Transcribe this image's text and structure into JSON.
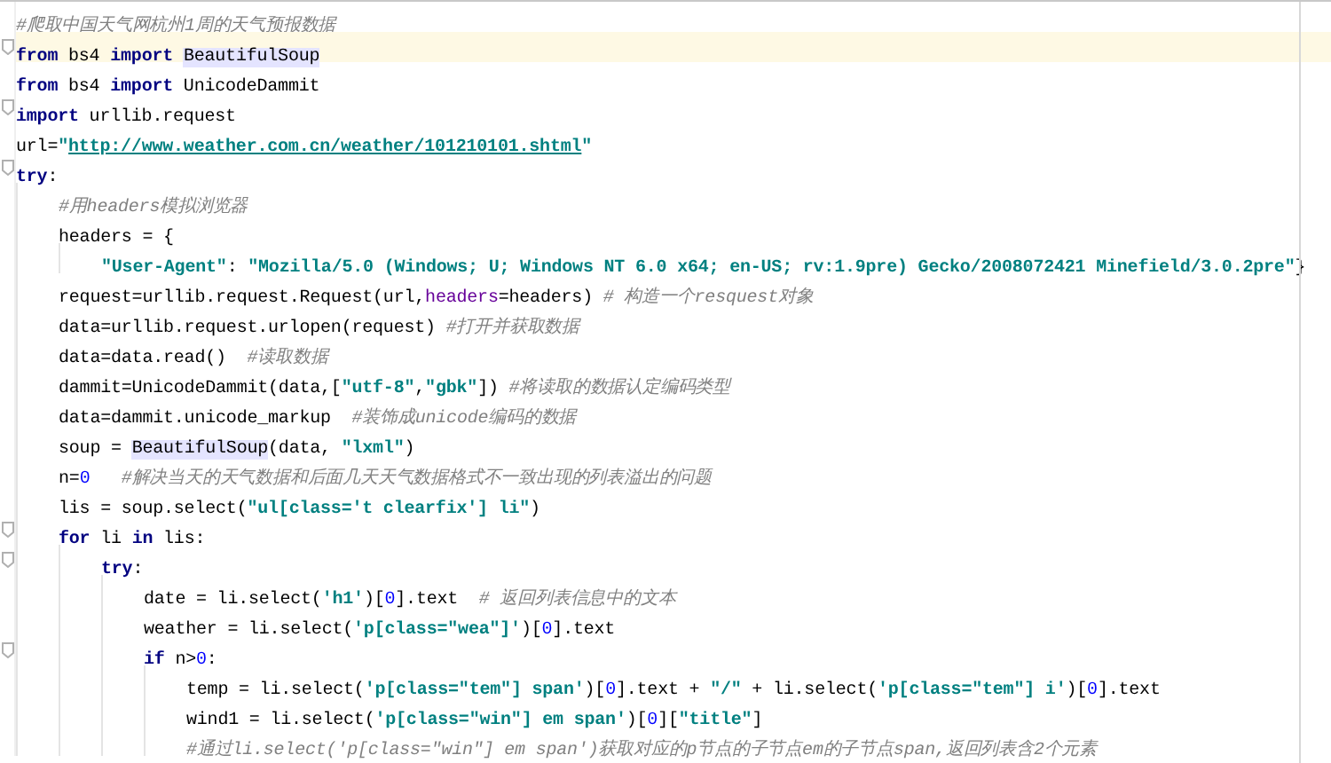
{
  "lines": [
    {
      "fold": false,
      "current": false,
      "tokens": [
        {
          "kind": "comment",
          "text": "#爬取中国天气网杭州1周的天气预报数据"
        }
      ]
    },
    {
      "fold": true,
      "current": true,
      "tokens": [
        {
          "kind": "kw",
          "text": "from"
        },
        {
          "kind": "plain",
          "text": " bs4 "
        },
        {
          "kind": "kw",
          "text": "import "
        },
        {
          "kind": "hl",
          "text": "BeautifulSoup"
        }
      ]
    },
    {
      "fold": false,
      "current": false,
      "tokens": [
        {
          "kind": "kw",
          "text": "from"
        },
        {
          "kind": "plain",
          "text": " bs4 "
        },
        {
          "kind": "kw",
          "text": "import"
        },
        {
          "kind": "plain",
          "text": " UnicodeDammit"
        }
      ]
    },
    {
      "fold": true,
      "current": false,
      "tokens": [
        {
          "kind": "kw",
          "text": "import"
        },
        {
          "kind": "plain",
          "text": " urllib.request"
        }
      ]
    },
    {
      "fold": false,
      "current": false,
      "tokens": [
        {
          "kind": "plain",
          "text": "url="
        },
        {
          "kind": "str",
          "text": "\""
        },
        {
          "kind": "link",
          "text": "http://www.weather.com.cn/weather/101210101.shtml"
        },
        {
          "kind": "str",
          "text": "\""
        }
      ]
    },
    {
      "fold": true,
      "current": false,
      "tokens": [
        {
          "kind": "kw",
          "text": "try"
        },
        {
          "kind": "plain",
          "text": ":"
        }
      ],
      "children": [
        {
          "fold": false,
          "current": false,
          "tokens": [
            {
              "kind": "comment",
              "text": "#用headers模拟浏览器"
            }
          ]
        },
        {
          "fold": false,
          "current": false,
          "tokens": [
            {
              "kind": "plain",
              "text": "headers = {"
            }
          ],
          "children": [
            {
              "fold": false,
              "current": false,
              "tokens": [
                {
                  "kind": "str",
                  "text": "\"User-Agent\""
                },
                {
                  "kind": "plain",
                  "text": ": "
                },
                {
                  "kind": "str",
                  "text": "\"Mozilla/5.0 (Windows; U; Windows NT 6.0 x64; en-US; rv:1.9pre) Gecko/2008072421 Minefield/3.0.2pre\""
                },
                {
                  "kind": "plain",
                  "text": "}"
                }
              ]
            }
          ]
        },
        {
          "fold": false,
          "current": false,
          "tokens": [
            {
              "kind": "plain",
              "text": "request=urllib.request.Request(url,"
            },
            {
              "kind": "param",
              "text": "headers"
            },
            {
              "kind": "plain",
              "text": "=headers) "
            },
            {
              "kind": "comment",
              "text": "# 构造一个resquest对象"
            }
          ]
        },
        {
          "fold": false,
          "current": false,
          "tokens": [
            {
              "kind": "plain",
              "text": "data=urllib.request.urlopen(request) "
            },
            {
              "kind": "comment",
              "text": "#打开并获取数据"
            }
          ]
        },
        {
          "fold": false,
          "current": false,
          "tokens": [
            {
              "kind": "plain",
              "text": "data=data.read()  "
            },
            {
              "kind": "comment",
              "text": "#读取数据"
            }
          ]
        },
        {
          "fold": false,
          "current": false,
          "tokens": [
            {
              "kind": "plain",
              "text": "dammit=UnicodeDammit(data,["
            },
            {
              "kind": "str",
              "text": "\"utf-8\""
            },
            {
              "kind": "plain",
              "text": ","
            },
            {
              "kind": "str",
              "text": "\"gbk\""
            },
            {
              "kind": "plain",
              "text": "]) "
            },
            {
              "kind": "comment",
              "text": "#将读取的数据认定编码类型"
            }
          ]
        },
        {
          "fold": false,
          "current": false,
          "tokens": [
            {
              "kind": "plain",
              "text": "data=dammit.unicode_markup  "
            },
            {
              "kind": "comment",
              "text": "#装饰成unicode编码的数据"
            }
          ]
        },
        {
          "fold": false,
          "current": false,
          "tokens": [
            {
              "kind": "plain",
              "text": "soup = "
            },
            {
              "kind": "hl",
              "text": "BeautifulSoup"
            },
            {
              "kind": "plain",
              "text": "(data, "
            },
            {
              "kind": "str",
              "text": "\"lxml\""
            },
            {
              "kind": "plain",
              "text": ")"
            }
          ]
        },
        {
          "fold": false,
          "current": false,
          "tokens": [
            {
              "kind": "plain",
              "text": "n="
            },
            {
              "kind": "num",
              "text": "0"
            },
            {
              "kind": "comment",
              "text": "   #解决当天的天气数据和后面几天天气数据格式不一致出现的列表溢出的问题"
            }
          ]
        },
        {
          "fold": false,
          "current": false,
          "tokens": [
            {
              "kind": "plain",
              "text": "lis = soup.select("
            },
            {
              "kind": "str",
              "text": "\"ul[class='t clearfix'] li\""
            },
            {
              "kind": "plain",
              "text": ")"
            }
          ]
        },
        {
          "fold": true,
          "current": false,
          "tokens": [
            {
              "kind": "kw",
              "text": "for"
            },
            {
              "kind": "plain",
              "text": " li "
            },
            {
              "kind": "kw",
              "text": "in"
            },
            {
              "kind": "plain",
              "text": " lis:"
            }
          ],
          "children": [
            {
              "fold": true,
              "current": false,
              "tokens": [
                {
                  "kind": "kw",
                  "text": "try"
                },
                {
                  "kind": "plain",
                  "text": ":"
                }
              ],
              "children": [
                {
                  "fold": false,
                  "current": false,
                  "tokens": [
                    {
                      "kind": "plain",
                      "text": "date = li.select("
                    },
                    {
                      "kind": "str",
                      "text": "'h1'"
                    },
                    {
                      "kind": "plain",
                      "text": ")["
                    },
                    {
                      "kind": "num",
                      "text": "0"
                    },
                    {
                      "kind": "plain",
                      "text": "].text  "
                    },
                    {
                      "kind": "comment",
                      "text": "# 返回列表信息中的文本"
                    }
                  ]
                },
                {
                  "fold": false,
                  "current": false,
                  "tokens": [
                    {
                      "kind": "plain",
                      "text": "weather = li.select("
                    },
                    {
                      "kind": "str",
                      "text": "'p[class=\"wea\"]'"
                    },
                    {
                      "kind": "plain",
                      "text": ")["
                    },
                    {
                      "kind": "num",
                      "text": "0"
                    },
                    {
                      "kind": "plain",
                      "text": "].text"
                    }
                  ]
                },
                {
                  "fold": true,
                  "current": false,
                  "tokens": [
                    {
                      "kind": "kw",
                      "text": "if"
                    },
                    {
                      "kind": "plain",
                      "text": " n>"
                    },
                    {
                      "kind": "num",
                      "text": "0"
                    },
                    {
                      "kind": "plain",
                      "text": ":"
                    }
                  ],
                  "children": [
                    {
                      "fold": false,
                      "current": false,
                      "tokens": [
                        {
                          "kind": "plain",
                          "text": "temp = li.select("
                        },
                        {
                          "kind": "str",
                          "text": "'p[class=\"tem\"] span'"
                        },
                        {
                          "kind": "plain",
                          "text": ")["
                        },
                        {
                          "kind": "num",
                          "text": "0"
                        },
                        {
                          "kind": "plain",
                          "text": "].text + "
                        },
                        {
                          "kind": "str",
                          "text": "\"/\""
                        },
                        {
                          "kind": "plain",
                          "text": " + li.select("
                        },
                        {
                          "kind": "str",
                          "text": "'p[class=\"tem\"] i'"
                        },
                        {
                          "kind": "plain",
                          "text": ")["
                        },
                        {
                          "kind": "num",
                          "text": "0"
                        },
                        {
                          "kind": "plain",
                          "text": "].text"
                        }
                      ]
                    },
                    {
                      "fold": false,
                      "current": false,
                      "tokens": [
                        {
                          "kind": "plain",
                          "text": "wind1 = li.select("
                        },
                        {
                          "kind": "str",
                          "text": "'p[class=\"win\"] em span'"
                        },
                        {
                          "kind": "plain",
                          "text": ")["
                        },
                        {
                          "kind": "num",
                          "text": "0"
                        },
                        {
                          "kind": "plain",
                          "text": "]["
                        },
                        {
                          "kind": "str",
                          "text": "\"title\""
                        },
                        {
                          "kind": "plain",
                          "text": "]"
                        }
                      ]
                    },
                    {
                      "fold": false,
                      "current": false,
                      "tokens": [
                        {
                          "kind": "comment",
                          "text": "#通过li.select('p[class=\"win\"] em span')获取对应的p节点的子节点em的子节点span,返回列表含2个元素"
                        }
                      ]
                    }
                  ]
                }
              ]
            }
          ]
        }
      ]
    }
  ]
}
